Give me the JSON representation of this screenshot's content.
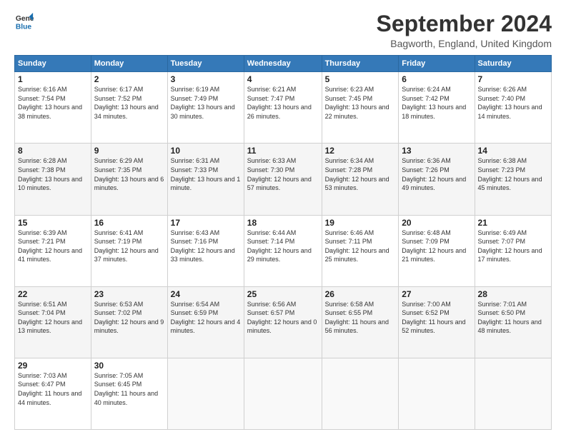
{
  "logo": {
    "line1": "General",
    "line2": "Blue"
  },
  "title": "September 2024",
  "location": "Bagworth, England, United Kingdom",
  "days_header": [
    "Sunday",
    "Monday",
    "Tuesday",
    "Wednesday",
    "Thursday",
    "Friday",
    "Saturday"
  ],
  "weeks": [
    [
      {
        "day": "1",
        "sunrise": "6:16 AM",
        "sunset": "7:54 PM",
        "daylight": "13 hours and 38 minutes."
      },
      {
        "day": "2",
        "sunrise": "6:17 AM",
        "sunset": "7:52 PM",
        "daylight": "13 hours and 34 minutes."
      },
      {
        "day": "3",
        "sunrise": "6:19 AM",
        "sunset": "7:49 PM",
        "daylight": "13 hours and 30 minutes."
      },
      {
        "day": "4",
        "sunrise": "6:21 AM",
        "sunset": "7:47 PM",
        "daylight": "13 hours and 26 minutes."
      },
      {
        "day": "5",
        "sunrise": "6:23 AM",
        "sunset": "7:45 PM",
        "daylight": "13 hours and 22 minutes."
      },
      {
        "day": "6",
        "sunrise": "6:24 AM",
        "sunset": "7:42 PM",
        "daylight": "13 hours and 18 minutes."
      },
      {
        "day": "7",
        "sunrise": "6:26 AM",
        "sunset": "7:40 PM",
        "daylight": "13 hours and 14 minutes."
      }
    ],
    [
      {
        "day": "8",
        "sunrise": "6:28 AM",
        "sunset": "7:38 PM",
        "daylight": "13 hours and 10 minutes."
      },
      {
        "day": "9",
        "sunrise": "6:29 AM",
        "sunset": "7:35 PM",
        "daylight": "13 hours and 6 minutes."
      },
      {
        "day": "10",
        "sunrise": "6:31 AM",
        "sunset": "7:33 PM",
        "daylight": "13 hours and 1 minute."
      },
      {
        "day": "11",
        "sunrise": "6:33 AM",
        "sunset": "7:30 PM",
        "daylight": "12 hours and 57 minutes."
      },
      {
        "day": "12",
        "sunrise": "6:34 AM",
        "sunset": "7:28 PM",
        "daylight": "12 hours and 53 minutes."
      },
      {
        "day": "13",
        "sunrise": "6:36 AM",
        "sunset": "7:26 PM",
        "daylight": "12 hours and 49 minutes."
      },
      {
        "day": "14",
        "sunrise": "6:38 AM",
        "sunset": "7:23 PM",
        "daylight": "12 hours and 45 minutes."
      }
    ],
    [
      {
        "day": "15",
        "sunrise": "6:39 AM",
        "sunset": "7:21 PM",
        "daylight": "12 hours and 41 minutes."
      },
      {
        "day": "16",
        "sunrise": "6:41 AM",
        "sunset": "7:19 PM",
        "daylight": "12 hours and 37 minutes."
      },
      {
        "day": "17",
        "sunrise": "6:43 AM",
        "sunset": "7:16 PM",
        "daylight": "12 hours and 33 minutes."
      },
      {
        "day": "18",
        "sunrise": "6:44 AM",
        "sunset": "7:14 PM",
        "daylight": "12 hours and 29 minutes."
      },
      {
        "day": "19",
        "sunrise": "6:46 AM",
        "sunset": "7:11 PM",
        "daylight": "12 hours and 25 minutes."
      },
      {
        "day": "20",
        "sunrise": "6:48 AM",
        "sunset": "7:09 PM",
        "daylight": "12 hours and 21 minutes."
      },
      {
        "day": "21",
        "sunrise": "6:49 AM",
        "sunset": "7:07 PM",
        "daylight": "12 hours and 17 minutes."
      }
    ],
    [
      {
        "day": "22",
        "sunrise": "6:51 AM",
        "sunset": "7:04 PM",
        "daylight": "12 hours and 13 minutes."
      },
      {
        "day": "23",
        "sunrise": "6:53 AM",
        "sunset": "7:02 PM",
        "daylight": "12 hours and 9 minutes."
      },
      {
        "day": "24",
        "sunrise": "6:54 AM",
        "sunset": "6:59 PM",
        "daylight": "12 hours and 4 minutes."
      },
      {
        "day": "25",
        "sunrise": "6:56 AM",
        "sunset": "6:57 PM",
        "daylight": "12 hours and 0 minutes."
      },
      {
        "day": "26",
        "sunrise": "6:58 AM",
        "sunset": "6:55 PM",
        "daylight": "11 hours and 56 minutes."
      },
      {
        "day": "27",
        "sunrise": "7:00 AM",
        "sunset": "6:52 PM",
        "daylight": "11 hours and 52 minutes."
      },
      {
        "day": "28",
        "sunrise": "7:01 AM",
        "sunset": "6:50 PM",
        "daylight": "11 hours and 48 minutes."
      }
    ],
    [
      {
        "day": "29",
        "sunrise": "7:03 AM",
        "sunset": "6:47 PM",
        "daylight": "11 hours and 44 minutes."
      },
      {
        "day": "30",
        "sunrise": "7:05 AM",
        "sunset": "6:45 PM",
        "daylight": "11 hours and 40 minutes."
      },
      null,
      null,
      null,
      null,
      null
    ]
  ]
}
